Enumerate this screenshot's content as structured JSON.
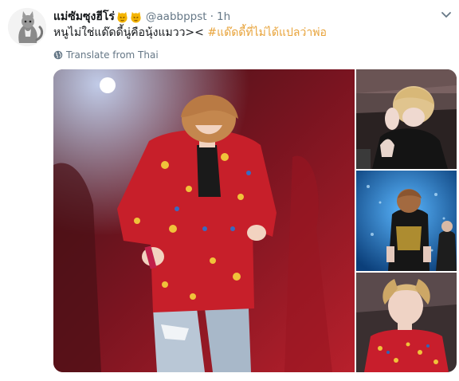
{
  "tweet": {
    "author_name": "แม่ซัมซุงฮีโร่",
    "author_handle": "@aabbppst",
    "separator": "·",
    "timestamp": "1h",
    "text_main": "หนูไม่ใช่แด๊ดดี้นู่คือนุ้งแมวว><",
    "text_hashtag": "#แด๊ดดี้ที่ไม่ได้แปลว่าพ่อ",
    "translate_label": "Translate from Thai"
  },
  "icons": {
    "avatar": "cat-avatar",
    "emoji": "cat-face-emoji",
    "caret": "chevron-down-icon",
    "translate": "globe-icon"
  },
  "colors": {
    "hashtag": "#e8a33a",
    "muted": "#657786",
    "text": "#14171a",
    "photo_red": "#b4182a",
    "photo_blue": "#1a73b8"
  },
  "media": {
    "photo_count": 4
  }
}
